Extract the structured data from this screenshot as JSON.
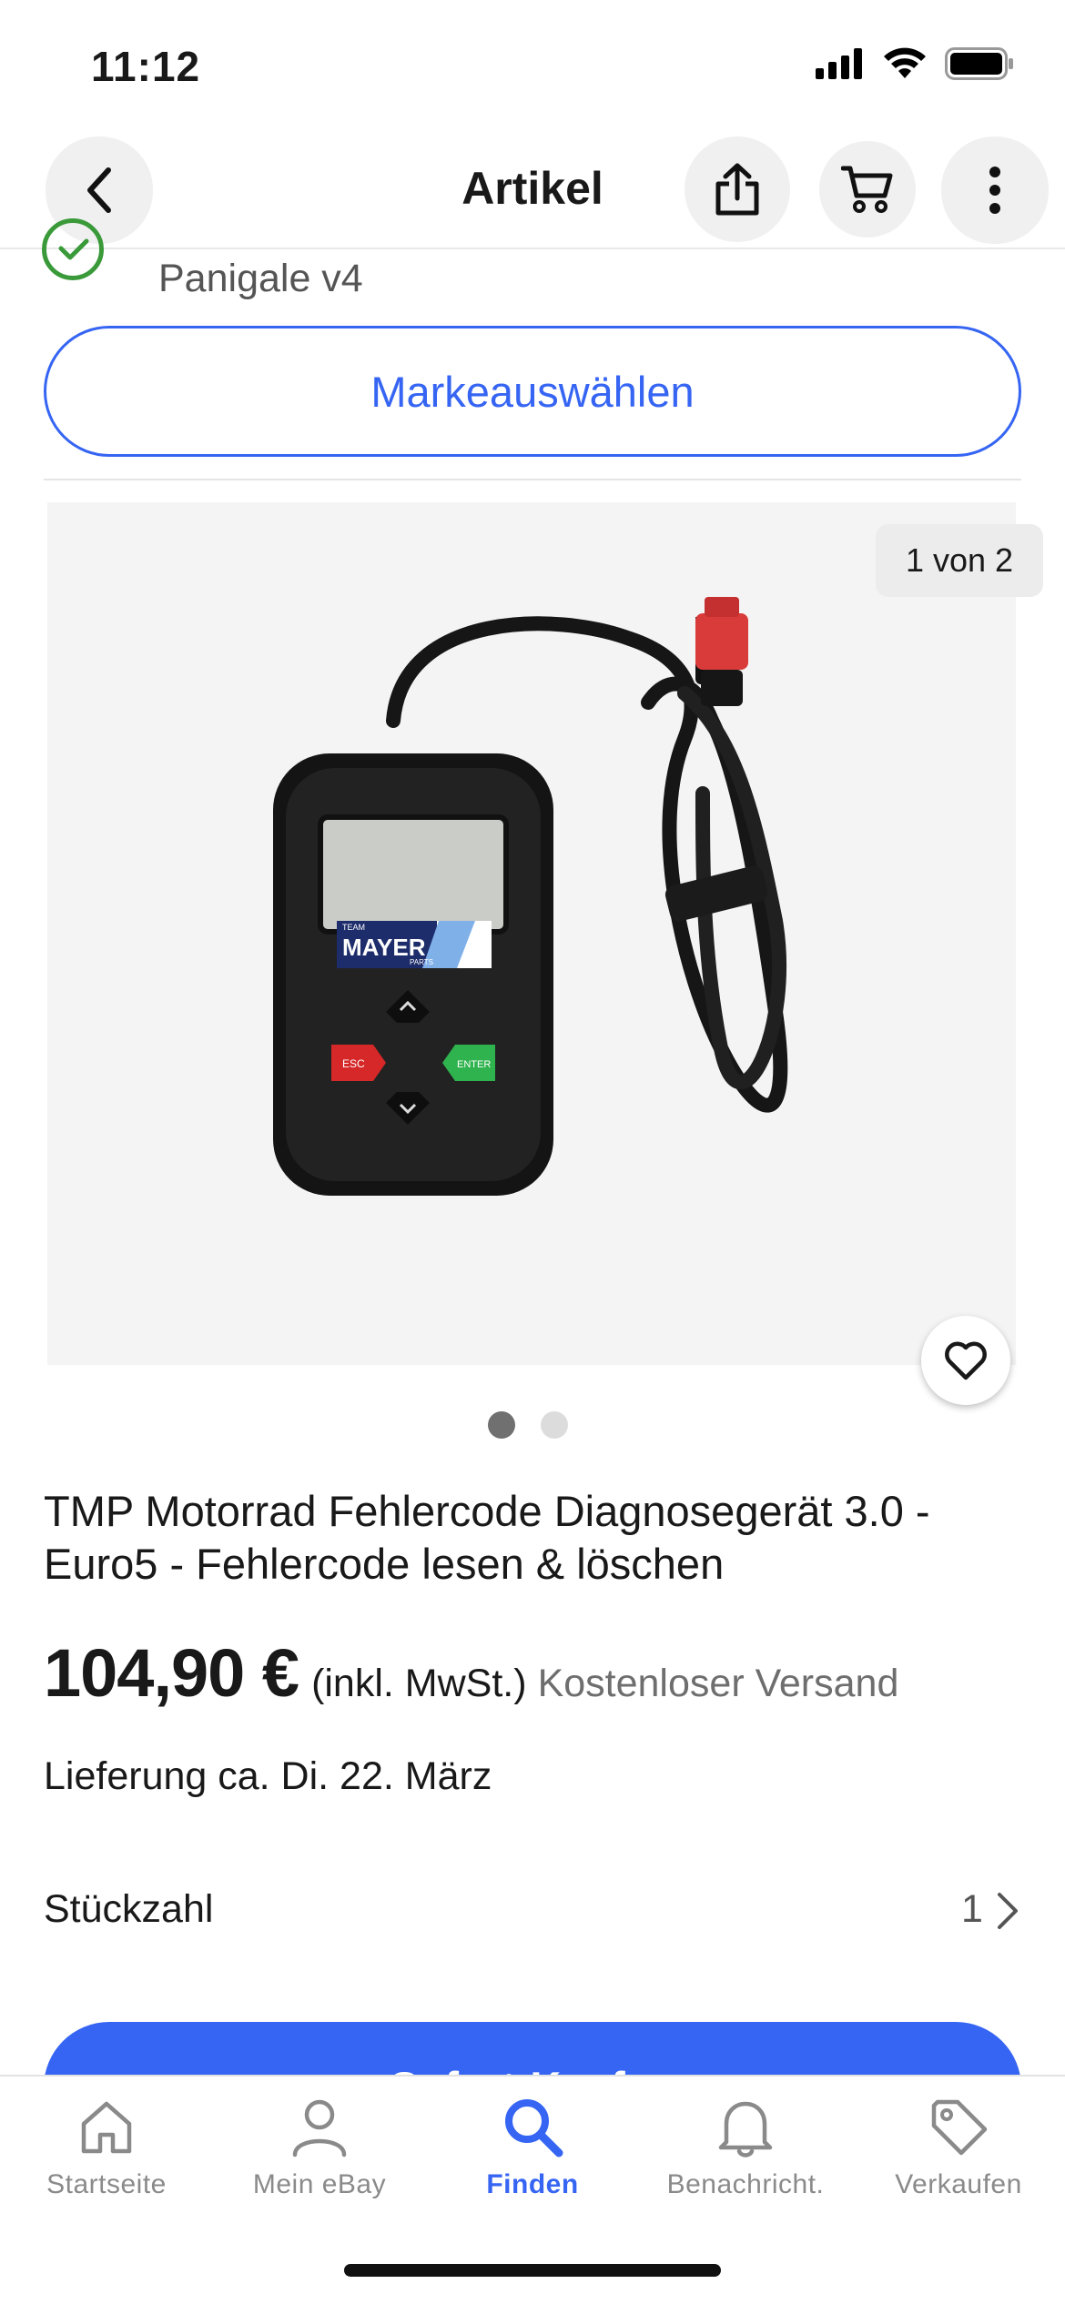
{
  "status_bar": {
    "time": "11:12"
  },
  "navbar": {
    "title": "Artikel"
  },
  "compatibility": {
    "model": "Panigale v4"
  },
  "brand_button": {
    "label": "Markeauswählen"
  },
  "gallery": {
    "counter": "1 von 2",
    "brand_text": "MAYER",
    "team_text": "TEAM",
    "parts_text": "PARTS",
    "esc_label": "ESC",
    "enter_label": "ENTER",
    "current_index": 1,
    "total": 2
  },
  "item": {
    "title": "TMP Motorrad Fehlercode Diagnosegerät 3.0 - Euro5 - Fehlercode lesen & löschen",
    "price": "104,90 €",
    "tax_note": "(inkl. MwSt.)",
    "shipping": "Kostenloser Versand",
    "delivery": "Lieferung ca. Di. 22. März"
  },
  "quantity": {
    "label": "Stückzahl",
    "value": "1"
  },
  "buy_button": {
    "label": "Sofort-Kaufen"
  },
  "tabbar": {
    "tabs": [
      {
        "label": "Startseite",
        "icon": "home-icon",
        "active": false
      },
      {
        "label": "Mein eBay",
        "icon": "person-icon",
        "active": false
      },
      {
        "label": "Finden",
        "icon": "search-icon",
        "active": true
      },
      {
        "label": "Benachricht.",
        "icon": "bell-icon",
        "active": false
      },
      {
        "label": "Verkaufen",
        "icon": "tag-icon",
        "active": false
      }
    ]
  },
  "colors": {
    "accent": "#3665f3",
    "check_green": "#3a9a3a",
    "text": "#191919",
    "muted": "#6e6e6e"
  }
}
